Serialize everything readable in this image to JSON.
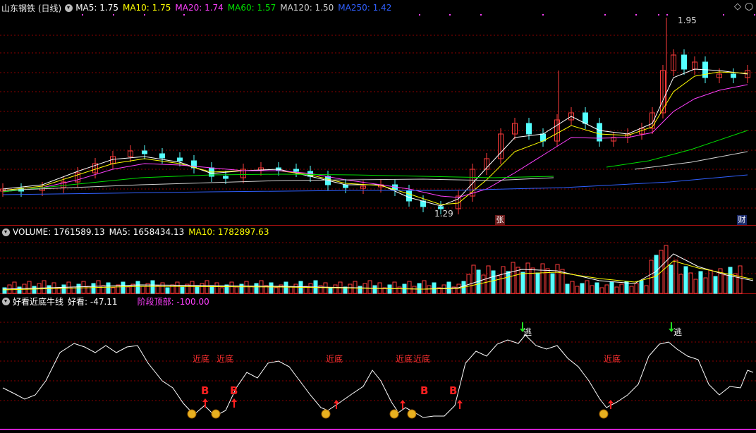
{
  "main_header": {
    "title": "山东钢铁 (日线)",
    "ma5": "MA5: 1.75",
    "ma10": "MA10: 1.75",
    "ma20": "MA20: 1.74",
    "ma60": "MA60: 1.57",
    "ma120": "MA120: 1.50",
    "ma250": "MA250: 1.42"
  },
  "price_labels": {
    "high": "1.95",
    "low": "1.29"
  },
  "markers": {
    "zhang": "张",
    "cai": "财"
  },
  "volume_header": {
    "volume": "VOLUME: 1761589.13",
    "ma5": "MA5: 1658434.13",
    "ma10": "MA10: 1782897.63"
  },
  "indicator_header": {
    "name": "好看近底牛线",
    "value": "好看: -47.11",
    "stage": "阶段顶部: -100.00"
  },
  "indicator_labels": {
    "near_bottom": "近底",
    "buy": "B",
    "escape": "逃"
  },
  "window_buttons": {
    "diamond": "◇",
    "circle": "○"
  },
  "colors": {
    "up": "#ff3b3b",
    "down": "#54ffff",
    "ma5": "#ffffff",
    "ma10": "#ffff00",
    "ma20": "#ff40ff",
    "ma60": "#00e000",
    "ma120": "#d0d0d0",
    "ma250": "#3060ff",
    "grid": "#8b0000",
    "stage": "#ff40ff"
  },
  "chart_data": {
    "type": "candlestick",
    "price_range": [
      1.29,
      1.95
    ],
    "series": [
      {
        "name": "MA5",
        "last": 1.75
      },
      {
        "name": "MA10",
        "last": 1.75
      },
      {
        "name": "MA20",
        "last": 1.74
      },
      {
        "name": "MA60",
        "last": 1.57
      },
      {
        "name": "MA120",
        "last": 1.5
      },
      {
        "name": "MA250",
        "last": 1.42
      }
    ],
    "volume": {
      "last": 1761589.13,
      "ma5": 1658434.13,
      "ma10": 1782897.63
    },
    "indicator": {
      "haokan": -47.11,
      "stage_top": -100.0
    }
  }
}
